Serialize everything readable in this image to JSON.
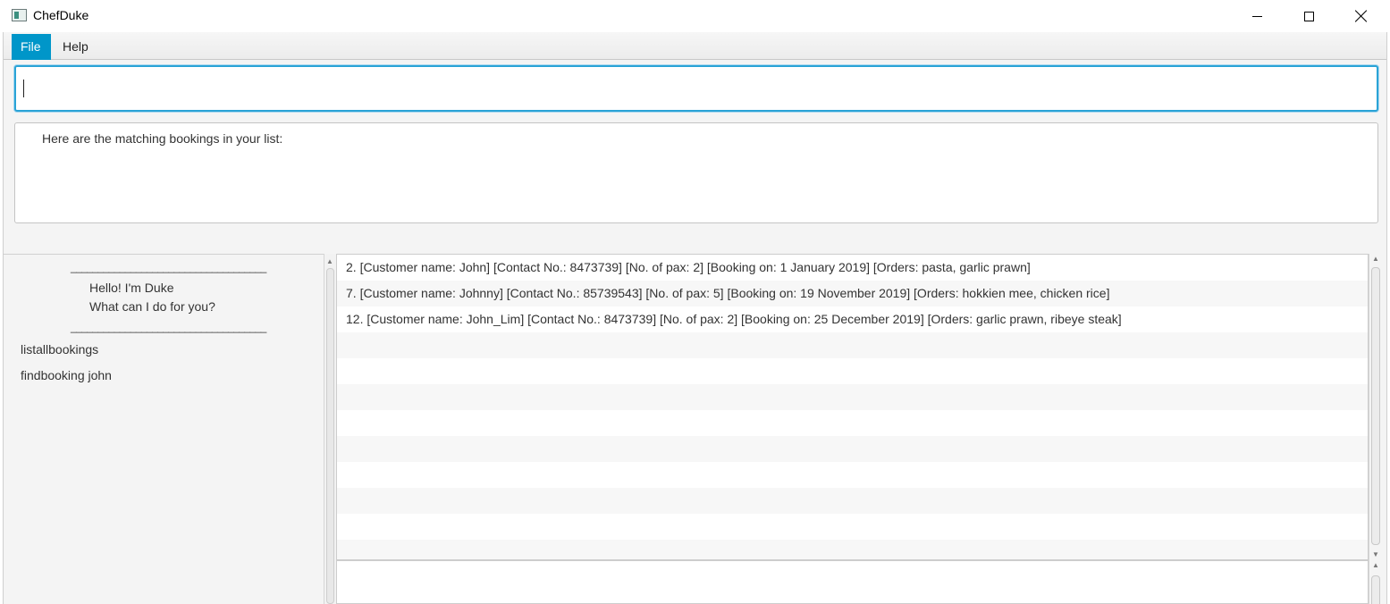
{
  "window": {
    "title": "ChefDuke",
    "icon": "app-window-icon"
  },
  "menu": {
    "items": [
      {
        "label": "File",
        "active": true
      },
      {
        "label": "Help",
        "active": false
      }
    ]
  },
  "command_input": {
    "value": "",
    "placeholder": ""
  },
  "response": {
    "text": "Here are the matching bookings in your list:"
  },
  "dialog": {
    "separator": "____________________________________",
    "greeting": [
      "Hello! I'm Duke",
      "What can I do for you?"
    ],
    "history": [
      "listallbookings",
      "findbooking john"
    ]
  },
  "bookings": [
    "2. [Customer name: John] [Contact No.: 8473739] [No. of pax: 2] [Booking on: 1 January 2019] [Orders: pasta, garlic prawn]",
    "7. [Customer name: Johnny] [Contact No.: 85739543] [No. of pax: 5] [Booking on: 19 November 2019] [Orders: hokkien mee, chicken rice]",
    "12. [Customer name: John_Lim] [Contact No.: 8473739] [No. of pax: 2] [Booking on: 25 December 2019] [Orders: garlic prawn, ribeye steak]",
    "",
    "",
    "",
    "",
    "",
    "",
    "",
    "",
    ""
  ],
  "colors": {
    "accent": "#0096c9",
    "focus_border": "#2aa3d6"
  }
}
